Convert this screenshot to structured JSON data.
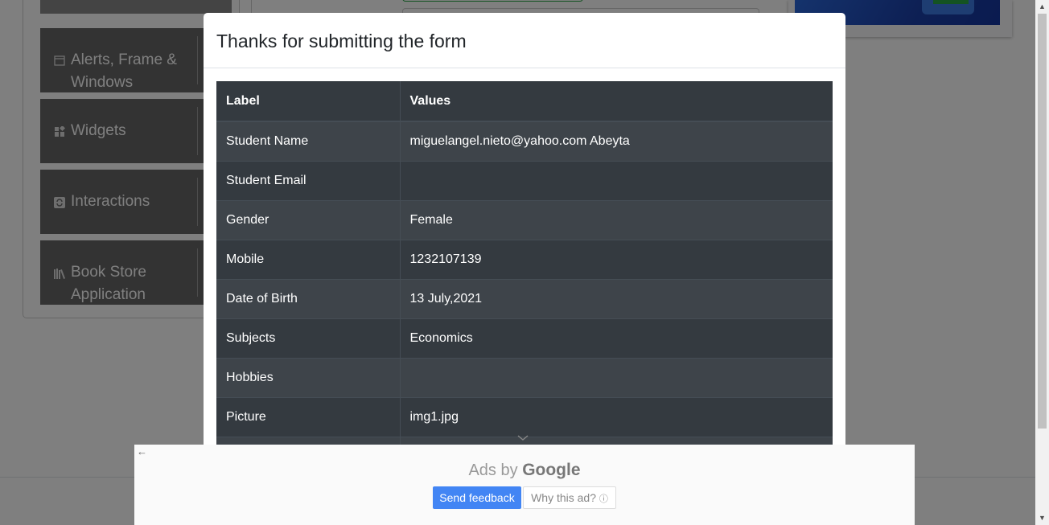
{
  "sidebar": {
    "groups": [
      {
        "label": "Alerts, Frame & Windows",
        "icon": "calendar-icon"
      },
      {
        "label": "Widgets",
        "icon": "widgets-icon"
      },
      {
        "label": "Interactions",
        "icon": "interactions-icon"
      },
      {
        "label": "Book Store Application",
        "icon": "books-icon"
      }
    ]
  },
  "modal": {
    "title": "Thanks for submitting the form",
    "table": {
      "headers": [
        "Label",
        "Values"
      ],
      "rows": [
        {
          "label": "Student Name",
          "value": "miguelangel.nieto@yahoo.com Abeyta"
        },
        {
          "label": "Student Email",
          "value": ""
        },
        {
          "label": "Gender",
          "value": "Female"
        },
        {
          "label": "Mobile",
          "value": "1232107139"
        },
        {
          "label": "Date of Birth",
          "value": "13 July,2021"
        },
        {
          "label": "Subjects",
          "value": "Economics"
        },
        {
          "label": "Hobbies",
          "value": ""
        },
        {
          "label": "Picture",
          "value": "img1.jpg"
        }
      ]
    }
  },
  "ad": {
    "ads_by": "Ads by",
    "brand": "Google",
    "send_feedback": "Send feedback",
    "why_this_ad": "Why this ad?",
    "info_glyph": "ⓘ",
    "back_glyph": "←"
  },
  "colors": {
    "table_dark": "#343a40",
    "table_light": "#3e444a",
    "feedback_blue": "#4285f4"
  }
}
